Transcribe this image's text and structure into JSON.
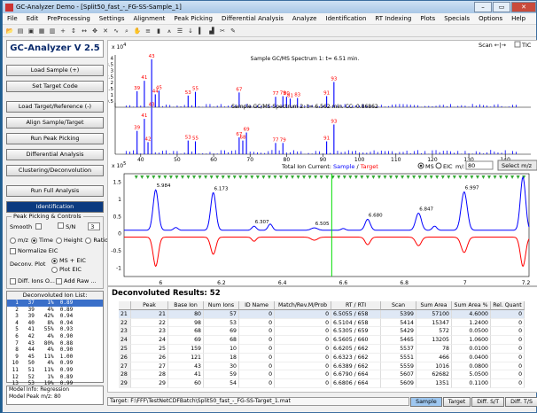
{
  "window": {
    "title": "GC-Analyzer Demo - [Split50_fast_-_FG-SS-Sample_1]"
  },
  "menu": [
    "File",
    "Edit",
    "PreProcessing",
    "Settings",
    "Alignment",
    "Peak Picking",
    "Differential Analysis",
    "Analyze",
    "Identification",
    "RT Indexing",
    "Plots",
    "Specials",
    "Options",
    "Help"
  ],
  "left": {
    "brand": "GC-Analyzer V 2.5",
    "buttons": [
      "Load Sample (+)",
      "Set Target Code",
      "Load Target/Reference (-)",
      "Align Sample/Target",
      "Run Peak Picking",
      "Differential Analysis",
      "Clustering/Deconvolution",
      "Run Full Analysis",
      "Identification"
    ],
    "peak_title": "Peak Picking & Controls",
    "smooth": "Smooth",
    "sn": "S/N",
    "sn_value": "3",
    "mode_options": [
      "m/z",
      "Time",
      "Height",
      "Ratio"
    ],
    "normalize": "Normalize EIC",
    "deconv_plot": "Deconv. Plot",
    "ms_eic": "MS + EIC",
    "plot_eic": "Plot EIC",
    "diff_ions": "Diff. Ions O...",
    "add_raw": "Add Raw ...",
    "ion_list_title": "Deconvoluted Ion List:",
    "ions": [
      [
        "1",
        "37",
        "1%",
        "0.89"
      ],
      [
        "2",
        "39",
        "4%",
        "0.89"
      ],
      [
        "3",
        "39",
        "42%",
        "0.94"
      ],
      [
        "4",
        "40",
        "8%",
        "0.94"
      ],
      [
        "5",
        "41",
        "55%",
        "0.93"
      ],
      [
        "6",
        "42",
        "4%",
        "0.90"
      ],
      [
        "7",
        "43",
        "80%",
        "0.88"
      ],
      [
        "8",
        "44",
        "4%",
        "0.90"
      ],
      [
        "9",
        "45",
        "11%",
        "1.00"
      ],
      [
        "10",
        "50",
        "4%",
        "0.99"
      ],
      [
        "11",
        "51",
        "11%",
        "0.99"
      ],
      [
        "12",
        "52",
        "1%",
        "0.89"
      ],
      [
        "13",
        "53",
        "19%",
        "0.99"
      ],
      [
        "14",
        "54",
        "5%",
        "0.90"
      ]
    ],
    "info_lines": [
      "Model Info: Regression",
      "Model Peak m/z: 80"
    ]
  },
  "plot": {
    "scan_label": "Scan ←|→",
    "tic": "TIC",
    "exp_label": "x 10",
    "exp_upper": "4",
    "exp_tic": "5",
    "spec1_title": "Sample GC/MS Spectrum 1: t= 6.51 min.",
    "spec2_title": "Sample GC/MS Spectrum 2: t= 6.562 min.  CC: 0.86862",
    "tic_title_a": "Total Ion Current: ",
    "tic_title_sample": "Sample",
    "tic_title_sep": " / ",
    "tic_title_target": "Target",
    "ms": "MS",
    "eic": "EIC",
    "mz": "m/:",
    "mz_value": "80",
    "select_mz": "Select m/z",
    "mz_axis": [
      "40",
      "50",
      "60",
      "70",
      "80",
      "90",
      "100",
      "110",
      "120",
      "130",
      "140"
    ],
    "spec1_y": [
      "4",
      "3.5",
      "3",
      "2.5",
      "2",
      "1.5",
      "1",
      "0.5"
    ],
    "spec1_peaks": [
      {
        "mz": 39,
        "h": 1.3,
        "label": "39"
      },
      {
        "mz": 41,
        "h": 2.15,
        "label": "41"
      },
      {
        "mz": 43,
        "h": 3.9,
        "label": "43"
      },
      {
        "mz": 44,
        "h": 1.05,
        "label": "44"
      },
      {
        "mz": 45,
        "h": 1.35,
        "label": "45"
      },
      {
        "mz": 53,
        "h": 0.95,
        "label": "53"
      },
      {
        "mz": 55,
        "h": 1.25,
        "label": "55"
      },
      {
        "mz": 67,
        "h": 1.2,
        "label": "67"
      },
      {
        "mz": 77,
        "h": 0.85,
        "label": "77"
      },
      {
        "mz": 79,
        "h": 0.9,
        "label": "79"
      },
      {
        "mz": 80,
        "h": 0.85,
        "label": "80"
      },
      {
        "mz": 81,
        "h": 0.7,
        "label": "81"
      },
      {
        "mz": 83,
        "h": 0.75,
        "label": "83"
      },
      {
        "mz": 91,
        "h": 0.9,
        "label": "91"
      },
      {
        "mz": 93,
        "h": 2.05,
        "label": "93"
      }
    ],
    "spec2_peaks": [
      {
        "mz": 39,
        "h": 1.45,
        "label": "39"
      },
      {
        "mz": 41,
        "h": 2.2,
        "label": "41"
      },
      {
        "mz": 42,
        "h": 0.75,
        "label": "42"
      },
      {
        "mz": 43,
        "h": 2.9,
        "label": "43"
      },
      {
        "mz": 53,
        "h": 0.85,
        "label": "53"
      },
      {
        "mz": 55,
        "h": 0.8,
        "label": "55"
      },
      {
        "mz": 67,
        "h": 1.05,
        "label": "67"
      },
      {
        "mz": 68,
        "h": 0.85,
        "label": "68"
      },
      {
        "mz": 69,
        "h": 1.35,
        "label": "69"
      },
      {
        "mz": 77,
        "h": 0.7,
        "label": "77"
      },
      {
        "mz": 79,
        "h": 0.7,
        "label": "79"
      },
      {
        "mz": 91,
        "h": 0.8,
        "label": "91"
      },
      {
        "mz": 93,
        "h": 1.85,
        "label": "93"
      }
    ],
    "tic_y": [
      "1.5",
      "1",
      "0.5",
      "0",
      "-0.5",
      "-1"
    ],
    "tic_x": [
      "6",
      "6.2",
      "6.4",
      "6.6",
      "6.8",
      "7",
      "7.2"
    ],
    "tic_peak_labels": [
      {
        "t": 5.984,
        "label": "5.984"
      },
      {
        "t": 6.173,
        "label": "6.173"
      },
      {
        "t": 6.307,
        "label": "6.307"
      },
      {
        "t": 6.505,
        "label": "6.505"
      },
      {
        "t": 6.68,
        "label": "6.680"
      },
      {
        "t": 6.847,
        "label": "6.847"
      },
      {
        "t": 6.997,
        "label": "6.997"
      }
    ],
    "marker_t": 6.562
  },
  "results": {
    "title": "Deconvoluted Results: 52",
    "columns": [
      "Peak",
      "Base Ion",
      "Num Ions",
      "ID Name",
      "Match/Rev.M/Prob",
      "RT / RTI",
      "Scan",
      "Sum Area",
      "Sum Area %",
      "Rel. Quant"
    ],
    "rows": [
      [
        "21",
        "21",
        "80",
        "57",
        "0",
        "0",
        "6.5055 / 658",
        "5399",
        "57100",
        "4.6000",
        "0"
      ],
      [
        "22",
        "22",
        "98",
        "53",
        "0",
        "0",
        "6.5104 / 658",
        "5414",
        "15347",
        "1.2400",
        "0"
      ],
      [
        "23",
        "23",
        "68",
        "69",
        "0",
        "0",
        "6.5305 / 659",
        "5429",
        "572",
        "0.0500",
        "0"
      ],
      [
        "24",
        "24",
        "69",
        "68",
        "0",
        "0",
        "6.5605 / 660",
        "5465",
        "13205",
        "1.0600",
        "0"
      ],
      [
        "25",
        "25",
        "159",
        "10",
        "0",
        "0",
        "6.6205 / 662",
        "5537",
        "78",
        "0.0100",
        "0"
      ],
      [
        "26",
        "26",
        "121",
        "18",
        "0",
        "0",
        "6.6323 / 662",
        "5551",
        "466",
        "0.0400",
        "0"
      ],
      [
        "27",
        "27",
        "43",
        "30",
        "0",
        "0",
        "6.6389 / 662",
        "5559",
        "1016",
        "0.0800",
        "0"
      ],
      [
        "28",
        "28",
        "41",
        "59",
        "0",
        "0",
        "6.6790 / 664",
        "5607",
        "62682",
        "5.0500",
        "0"
      ],
      [
        "29",
        "29",
        "60",
        "54",
        "0",
        "0",
        "6.6806 / 664",
        "5609",
        "1351",
        "0.1100",
        "0"
      ]
    ]
  },
  "status": {
    "target_path": "Target: F:\\FFF\\TestNetCDFBatch\\Split50_fast_-_FG-SS-Target_1.mat",
    "buttons": [
      "Sample",
      "Target",
      "Diff. S/T",
      "Diff. T/S"
    ]
  },
  "colors": {
    "sample": "#0000ff",
    "target": "#ff0000",
    "marker": "#00cc00",
    "brand": "#0a2a6b"
  }
}
